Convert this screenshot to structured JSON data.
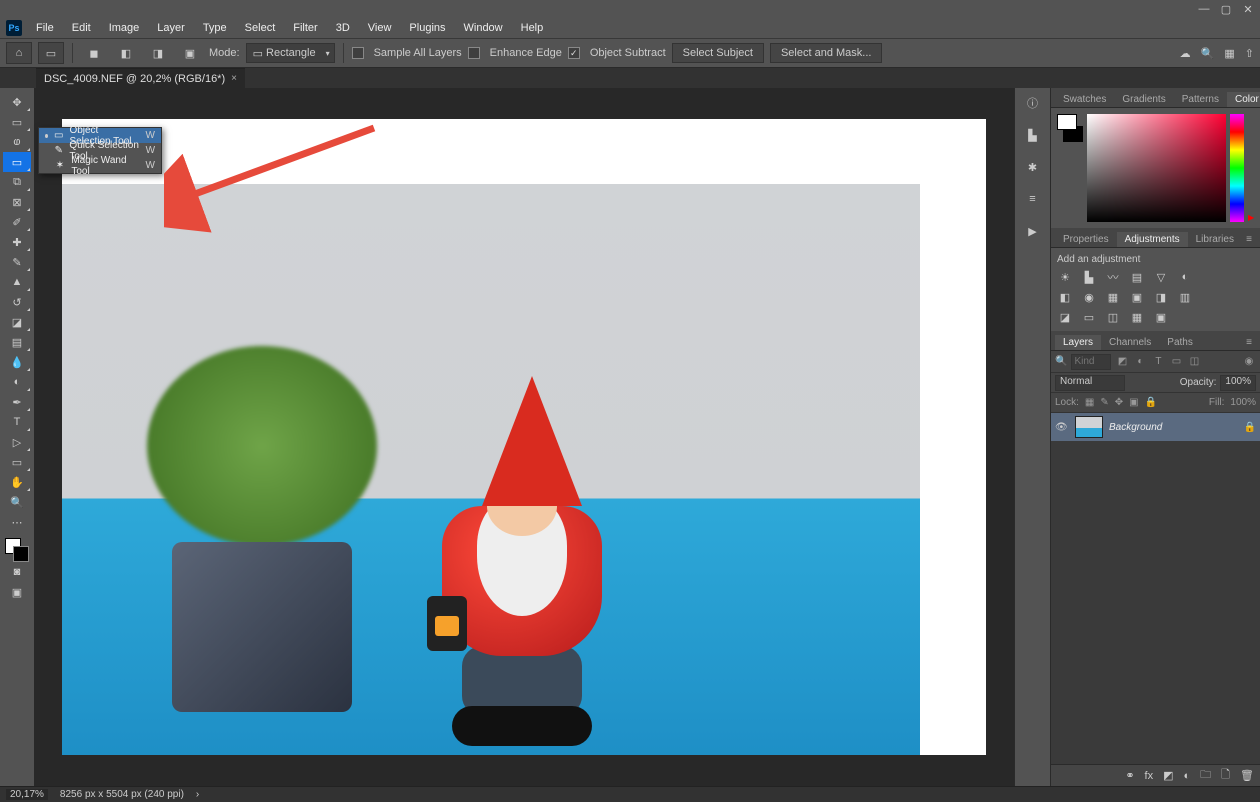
{
  "menubar": [
    "File",
    "Edit",
    "Image",
    "Layer",
    "Type",
    "Select",
    "Filter",
    "3D",
    "View",
    "Plugins",
    "Window",
    "Help"
  ],
  "optionbar": {
    "mode_label": "Mode:",
    "mode_value": "Rectangle",
    "sample_all": "Sample All Layers",
    "enhance_edge": "Enhance Edge",
    "object_subtract": "Object Subtract",
    "select_subject": "Select Subject",
    "select_and_mask": "Select and Mask..."
  },
  "document": {
    "tab_title": "DSC_4009.NEF @ 20,2% (RGB/16*)"
  },
  "tool_flyout": {
    "items": [
      {
        "label": "Object Selection Tool",
        "key": "W",
        "selected": true,
        "icon": "▭"
      },
      {
        "label": "Quick Selection Tool",
        "key": "W",
        "selected": false,
        "icon": "✎"
      },
      {
        "label": "Magic Wand Tool",
        "key": "W",
        "selected": false,
        "icon": "✶"
      }
    ]
  },
  "panel_tabs_color": [
    "Swatches",
    "Gradients",
    "Patterns",
    "Color"
  ],
  "panel_tabs_adjust": [
    "Properties",
    "Adjustments",
    "Libraries"
  ],
  "adjustments": {
    "hint": "Add an adjustment"
  },
  "panel_tabs_layers": [
    "Layers",
    "Channels",
    "Paths"
  ],
  "layers": {
    "search_placeholder": "Kind",
    "normal": "Normal",
    "opacity_label": "Opacity:",
    "opacity_value": "100%",
    "lock_label": "Lock:",
    "fill_label": "Fill:",
    "fill_value": "100%",
    "background_layer": "Background"
  },
  "statusbar": {
    "zoom": "20,17%",
    "dims": "8256 px x 5504 px (240 ppi)"
  }
}
